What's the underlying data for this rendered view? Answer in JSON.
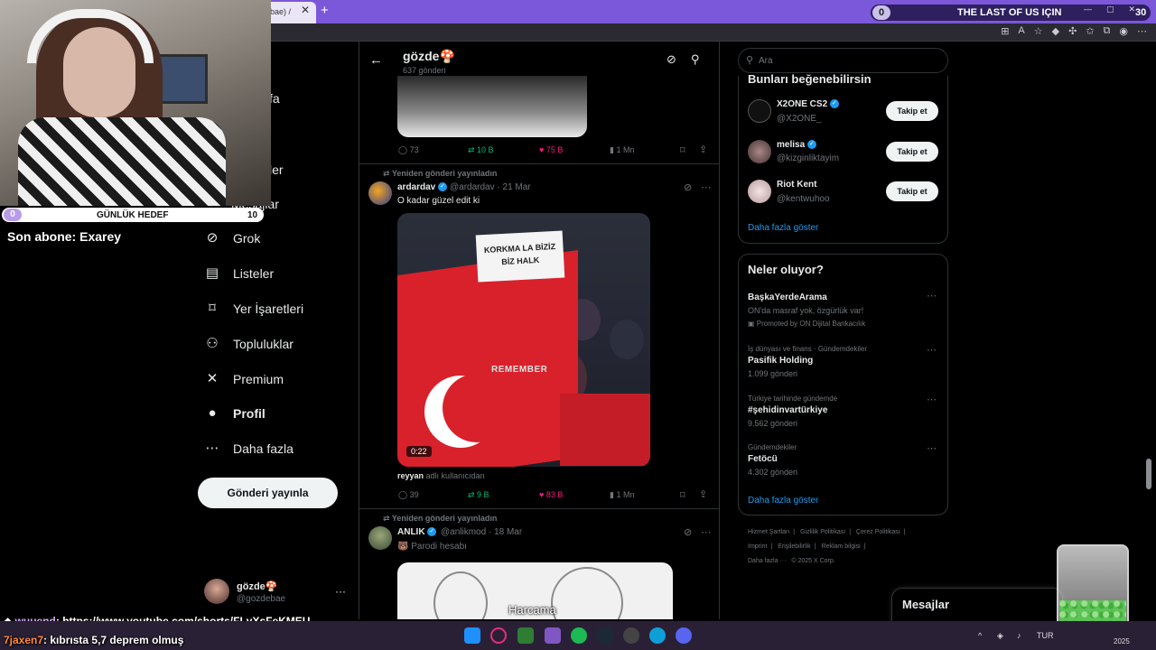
{
  "browser": {
    "tab_title": "ebae) /",
    "tab_close": "✕",
    "new_tab": "+"
  },
  "hype_train": {
    "count": "0",
    "title": "THE LAST OF US IÇIN",
    "goal": "30"
  },
  "stream_overlay": {
    "goal_current": "0",
    "goal_label": "GÜNLÜK HEDEF",
    "goal_max": "10",
    "last_sub": "Son abone: Exarey"
  },
  "nav": {
    "partial_items": [
      "fa",
      "ler",
      "Mesajlar"
    ],
    "items": [
      {
        "label": "Grok",
        "icon": "grok-icon",
        "glyph": "⊘"
      },
      {
        "label": "Listeler",
        "icon": "lists-icon",
        "glyph": "▤"
      },
      {
        "label": "Yer İşaretleri",
        "icon": "bookmark-icon",
        "glyph": "⌑"
      },
      {
        "label": "Topluluklar",
        "icon": "communities-icon",
        "glyph": "⚇"
      },
      {
        "label": "Premium",
        "icon": "x-logo-icon",
        "glyph": "✕"
      },
      {
        "label": "Profil",
        "icon": "profile-icon",
        "glyph": "●"
      },
      {
        "label": "Daha fazla",
        "icon": "more-icon",
        "glyph": "⋯"
      }
    ],
    "post_button": "Gönderi yayınla",
    "account_name": "gözde🍄",
    "account_handle": "@gozdebae",
    "account_more": "···"
  },
  "profile_header": {
    "back": "←",
    "name": "gözde🍄",
    "post_count": "637 gönderi"
  },
  "tweets": [
    {
      "replies": "73",
      "reposts": "10 B",
      "likes": "75 B",
      "views": "1 Mn"
    },
    {
      "repost_note": "Yeniden gönderi yayınladın",
      "author": "ardardav",
      "handle": "@ardardav",
      "date": "21 Mar",
      "text": "O kadar güzel edit ki",
      "sign_text": "KORKMA LA BİZİZ BİZ HALK",
      "video_overlay": "REMEMBER",
      "duration": "0:22",
      "caption_user": "reyyan",
      "caption_suffix": "adlı kullanıcıdan",
      "replies": "39",
      "reposts": "9 B",
      "likes": "83 B",
      "views": "1 Mn"
    },
    {
      "repost_note": "Yeniden gönderi yayınladın",
      "author": "ANLIK",
      "handle": "@anlikmod",
      "date": "18 Mar",
      "text": "🐻 Parodi hesabı",
      "subtitle": "Harcama"
    }
  ],
  "search": {
    "placeholder": "Ara"
  },
  "who_to_follow": {
    "title": "Bunları beğenebilirsin",
    "follow_label": "Takip et",
    "show_more": "Daha fazla göster",
    "users": [
      {
        "name": "X2ONE CS2",
        "handle": "@X2ONE_"
      },
      {
        "name": "melisa",
        "handle": "@kizginliktayim"
      },
      {
        "name": "Riot Kent",
        "handle": "@kentwuhoo"
      }
    ]
  },
  "trends": {
    "title": "Neler oluyor?",
    "show_more": "Daha fazla göster",
    "items": [
      {
        "category": "",
        "name": "BaşkaYerdeArama",
        "sub": "ON'da masraf yok, özgürlük var!",
        "extra": "Promoted by ON Dijital Bankacılık"
      },
      {
        "category": "İş dünyası ve finans · Gündemdekiler",
        "name": "Pasifik Holding",
        "sub": "1.099 gönderi",
        "extra": ""
      },
      {
        "category": "Türkiye tarihinde gündemde",
        "name": "#şehidinvartürkiye",
        "sub": "9.562 gönderi",
        "extra": ""
      },
      {
        "category": "Gündemdekiler",
        "name": "Fetöcü",
        "sub": "4.302 gönderi",
        "extra": ""
      }
    ]
  },
  "footer": {
    "links": [
      "Hizmet Şartları",
      "|",
      "Gizlilik Politikası",
      "|",
      "Çerez Politikası",
      "|",
      "Imprint",
      "|",
      "Erişilebilirlik",
      "|",
      "Reklam bilgisi",
      "|",
      "Daha fazla ···",
      "© 2025 X Corp."
    ]
  },
  "messages_drawer": {
    "title": "Mesajlar"
  },
  "chat": [
    {
      "user": "wuuend",
      "text": ": https://www.youtube.com/shorts/FLvXsFeKMEU",
      "color": "#d8a7ff"
    },
    {
      "user": "7jaxen7",
      "text": ": kıbrısta 5,7 deprem olmuş",
      "color": "#ff8a3d"
    }
  ],
  "taskbar": {
    "lang": "TUR",
    "year": "2025"
  },
  "colors": {
    "accent": "#1d9bf0",
    "like": "#f91880",
    "repost": "#00ba7c",
    "tabbar": "#7b57d9"
  }
}
